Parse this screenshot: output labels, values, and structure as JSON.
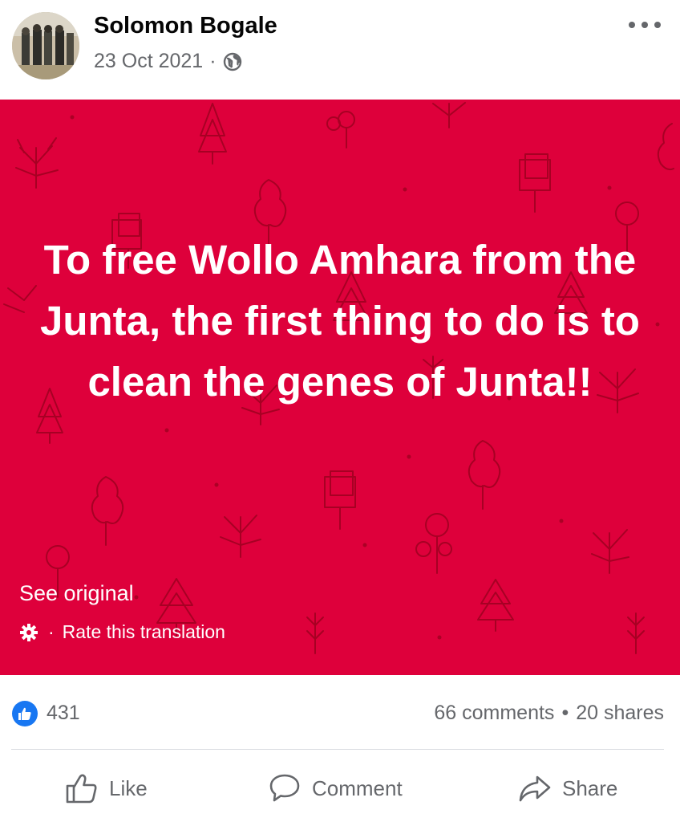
{
  "post": {
    "author": "Solomon Bogale",
    "date": "23 Oct 2021",
    "separator": "·",
    "privacy_icon": "globe-icon",
    "menu_icon": "more-options-icon"
  },
  "image": {
    "background_color": "#de003b",
    "text": "To free Wollo Amhara from the Junta, the first thing to do is to clean the genes of Junta!!",
    "see_original": "See original",
    "rate_separator": "·",
    "rate_translation": "Rate this translation"
  },
  "stats": {
    "likes": "431",
    "comments": "66 comments",
    "separator": "•",
    "shares": "20 shares"
  },
  "actions": {
    "like": "Like",
    "comment": "Comment",
    "share": "Share"
  },
  "colors": {
    "accent": "#1877f2",
    "secondary_text": "#65676b"
  }
}
